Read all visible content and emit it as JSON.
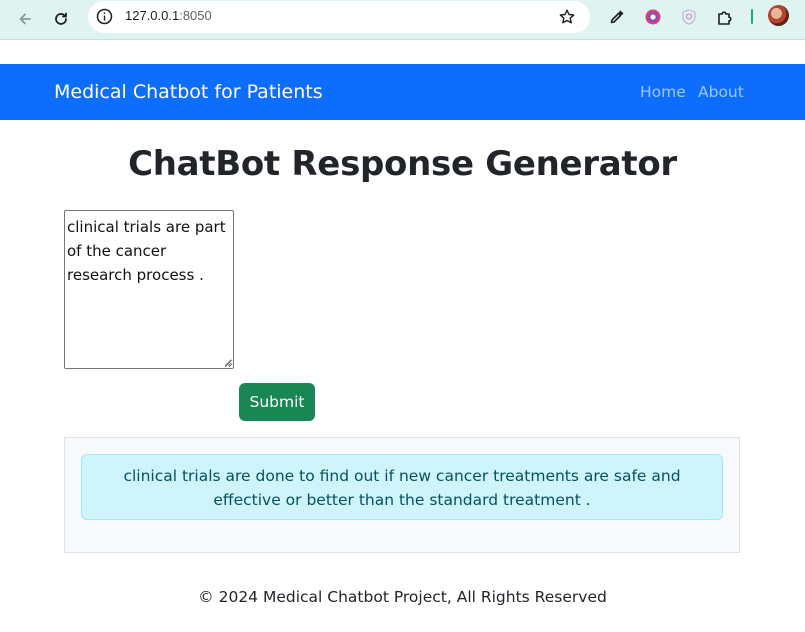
{
  "browser": {
    "url_host": "127.0.0.1",
    "url_port": ":8050",
    "icons": [
      "back-arrow-icon",
      "reload-icon",
      "site-info-icon",
      "bookmark-star-icon",
      "eyedropper-icon",
      "color-picker-icon",
      "shield-extension-icon",
      "extensions-puzzle-icon",
      "profile-avatar"
    ]
  },
  "navbar": {
    "brand": "Medical Chatbot for Patients",
    "links": [
      "Home",
      "About"
    ],
    "background": "#0d6efd"
  },
  "main": {
    "title": "ChatBot Response Generator",
    "input_value": "clinical trials are part of the cancer research process .",
    "submit_label": "Submit",
    "response_text": "clinical trials are done to find out if new cancer treatments are safe and effective or better than the standard treatment ."
  },
  "footer": {
    "text": "© 2024 Medical Chatbot Project, All Rights Reserved"
  },
  "colors": {
    "primary": "#0d6efd",
    "success": "#198754",
    "info_bg": "#cff4fc",
    "info_text": "#055160"
  }
}
